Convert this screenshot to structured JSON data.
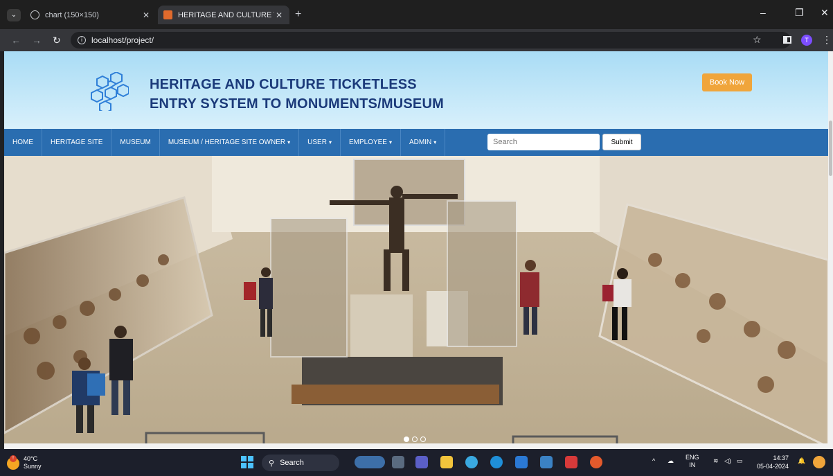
{
  "browser": {
    "tabs": [
      {
        "title": "chart (150×150)",
        "active": false
      },
      {
        "title": "HERITAGE AND CULTURE TICKE",
        "active": true
      }
    ],
    "url": "localhost/project/"
  },
  "site": {
    "title_line1": "HERITAGE AND CULTURE TICKETLESS",
    "title_line2": "ENTRY SYSTEM TO MONUMENTS/MUSEUM",
    "book_label": "Book Now",
    "nav": [
      {
        "label": "HOME",
        "dropdown": false
      },
      {
        "label": "HERITAGE SITE",
        "dropdown": false
      },
      {
        "label": "MUSEUM",
        "dropdown": false
      },
      {
        "label": "MUSEUM / HERITAGE SITE OWNER",
        "dropdown": true
      },
      {
        "label": "USER",
        "dropdown": true
      },
      {
        "label": "EMPLOYEE",
        "dropdown": true
      },
      {
        "label": "ADMIN",
        "dropdown": true
      }
    ],
    "search_placeholder": "Search",
    "submit_label": "Submit",
    "carousel": {
      "slides": 3,
      "active": 1
    }
  },
  "taskbar": {
    "temp": "40°C",
    "condition": "Sunny",
    "search_label": "Search",
    "lang_top": "ENG",
    "lang_bottom": "IN",
    "time": "14:37",
    "date": "05-04-2024"
  },
  "colors": {
    "nav_bg": "#2a6db0",
    "title": "#1b3a7a",
    "book_button": "#f0a53b",
    "header_bg": "#bfe6f8"
  }
}
